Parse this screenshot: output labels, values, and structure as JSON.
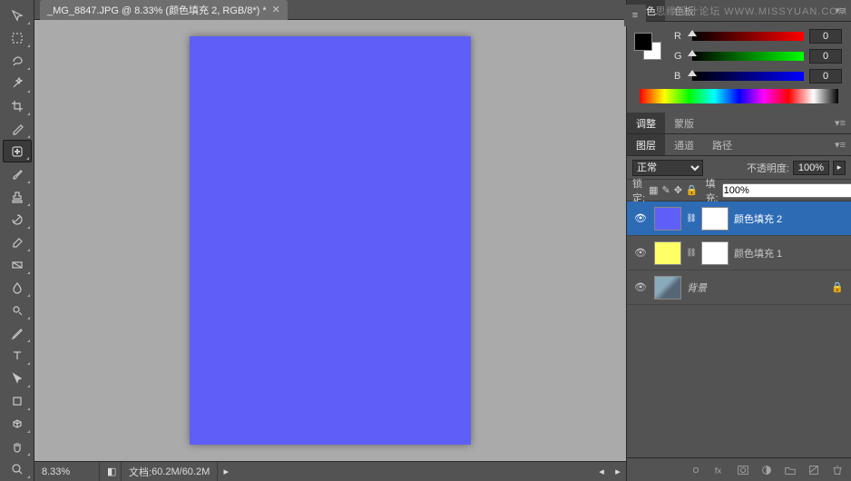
{
  "watermark": {
    "text": "思缘设计论坛",
    "url": "WWW.MISSYUAN.COM"
  },
  "document": {
    "tab_title": "_MG_8847.JPG @ 8.33% (颜色填充 2, RGB/8*) *",
    "zoom": "8.33%",
    "doc_label": "文档:",
    "doc_size": "60.2M/60.2M"
  },
  "color_panel": {
    "tabs": [
      "颜色",
      "色板"
    ],
    "channels": [
      {
        "label": "R",
        "value": "0",
        "class": "r"
      },
      {
        "label": "G",
        "value": "0",
        "class": "g"
      },
      {
        "label": "B",
        "value": "0",
        "class": "b"
      }
    ]
  },
  "adjust_panel": {
    "tabs": [
      "调整",
      "蒙版"
    ]
  },
  "layer_panel": {
    "tabs": [
      "图层",
      "通道",
      "路径"
    ],
    "blend_mode": "正常",
    "opacity_label": "不透明度:",
    "opacity": "100%",
    "lock_label": "锁定:",
    "fill_label": "填充:",
    "fill": "100%",
    "layers": [
      {
        "name": "颜色填充 2",
        "thumb": "fill-blue",
        "has_mask": true,
        "selected": true,
        "locked": false
      },
      {
        "name": "颜色填充 1",
        "thumb": "fill-yellow",
        "has_mask": true,
        "selected": false,
        "locked": false
      },
      {
        "name": "背景",
        "thumb": "bg-img",
        "has_mask": false,
        "selected": false,
        "locked": true,
        "italic": true
      }
    ]
  },
  "tools": [
    "move",
    "marquee",
    "lasso",
    "wand",
    "crop",
    "eyedropper",
    "healing",
    "brush",
    "stamp",
    "history-brush",
    "eraser",
    "gradient",
    "blur",
    "dodge",
    "pen",
    "type",
    "path-select",
    "shape",
    "3d",
    "hand",
    "zoom"
  ]
}
